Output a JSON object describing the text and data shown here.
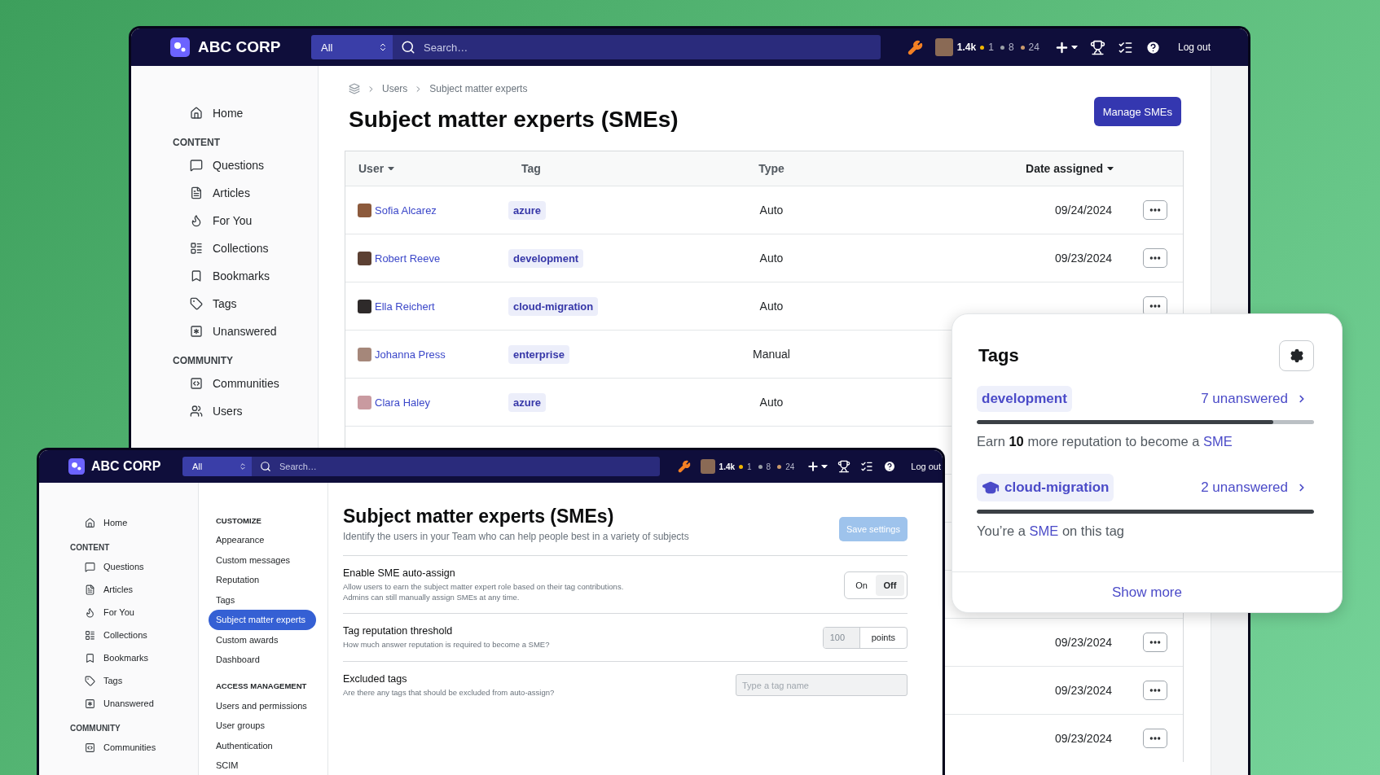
{
  "back_window": {
    "header": {
      "brand": "ABC CORP",
      "search_scope": "All",
      "search_placeholder": "Search…",
      "reputation": "1.4k",
      "badges": [
        {
          "count": "1",
          "color": "#f1b600"
        },
        {
          "count": "8",
          "color": "#9a9fa5"
        },
        {
          "count": "24",
          "color": "#c9996b"
        }
      ],
      "logout": "Log out"
    },
    "sidebar": [
      {
        "items": [
          "Home"
        ]
      },
      {
        "heading": "CONTENT",
        "items": [
          "Questions",
          "Articles",
          "For You",
          "Collections",
          "Bookmarks",
          "Tags",
          "Unanswered"
        ]
      },
      {
        "heading": "COMMUNITY",
        "items": [
          "Communities",
          "Users"
        ]
      }
    ],
    "breadcrumb": [
      "Users",
      "Subject matter experts"
    ],
    "title": "Subject matter experts (SMEs)",
    "manage_button": "Manage SMEs",
    "table": {
      "columns": [
        {
          "label": "User",
          "sortable": true,
          "selected": false
        },
        {
          "label": "Tag",
          "sortable": false,
          "selected": false
        },
        {
          "label": "Type",
          "sortable": false,
          "selected": false
        },
        {
          "label": "Date assigned",
          "sortable": true,
          "selected": true
        }
      ],
      "rows": [
        {
          "user": "Sofia Alcarez",
          "tag": "azure",
          "type": "Auto",
          "date": "09/24/2024"
        },
        {
          "user": "Robert Reeve",
          "tag": "development",
          "type": "Auto",
          "date": "09/23/2024"
        },
        {
          "user": "Ella Reichert",
          "tag": "cloud-migration",
          "type": "Auto"
        },
        {
          "user": "Johanna Press",
          "tag": "enterprise",
          "type": "Manual"
        },
        {
          "user": "Clara Haley",
          "tag": "azure",
          "type": "Auto"
        }
      ],
      "lower_rows": [
        {
          "date": "09/23/2024"
        },
        {
          "date": "09/23/2024"
        },
        {
          "date": "09/23/2024"
        }
      ]
    }
  },
  "front_window": {
    "header": {
      "brand": "ABC CORP",
      "search_scope": "All",
      "search_placeholder": "Search…",
      "reputation": "1.4k",
      "badges": [
        {
          "count": "1",
          "color": "#f1b600"
        },
        {
          "count": "8",
          "color": "#9a9fa5"
        },
        {
          "count": "24",
          "color": "#c9996b"
        }
      ],
      "logout": "Log out"
    },
    "sidebar": [
      {
        "items": [
          "Home"
        ]
      },
      {
        "heading": "CONTENT",
        "items": [
          "Questions",
          "Articles",
          "For You",
          "Collections",
          "Bookmarks",
          "Tags",
          "Unanswered"
        ]
      },
      {
        "heading": "COMMUNITY",
        "items": [
          "Communities"
        ]
      }
    ],
    "settings_nav": [
      {
        "heading": "CUSTOMIZE",
        "items": [
          {
            "label": "Appearance",
            "selected": false
          },
          {
            "label": "Custom messages",
            "selected": false
          },
          {
            "label": "Reputation",
            "selected": false
          },
          {
            "label": "Tags",
            "selected": false
          },
          {
            "label": "Subject matter experts",
            "selected": true
          },
          {
            "label": "Custom awards",
            "selected": false
          },
          {
            "label": "Dashboard",
            "selected": false
          }
        ]
      },
      {
        "heading": "ACCESS MANAGEMENT",
        "items": [
          {
            "label": "Users and permissions",
            "selected": false
          },
          {
            "label": "User groups",
            "selected": false
          },
          {
            "label": "Authentication",
            "selected": false
          },
          {
            "label": "SCIM",
            "selected": false
          }
        ]
      }
    ],
    "page": {
      "title": "Subject matter experts (SMEs)",
      "subtitle": "Identify the users in your Team who can help people best in a variety of subjects",
      "save_button": {
        "label": "Save settings",
        "disabled": true
      },
      "settings": [
        {
          "kind": "toggle",
          "label": "Enable SME auto-assign",
          "description": [
            "Allow users to earn the subject matter expert role based on their tag contributions.",
            "Admins can still manually assign SMEs at any time."
          ],
          "options": [
            {
              "label": "On",
              "selected": false
            },
            {
              "label": "Off",
              "selected": true
            }
          ]
        },
        {
          "kind": "number",
          "label": "Tag reputation threshold",
          "description": [
            "How much answer reputation is required to become a SME?"
          ],
          "value": "100",
          "unit": "points"
        },
        {
          "kind": "tags",
          "label": "Excluded tags",
          "description": [
            "Are there any tags that should be excluded from auto-assign?"
          ],
          "placeholder": "Type a tag name"
        }
      ]
    }
  },
  "tags_card": {
    "title": "Tags",
    "tags": [
      {
        "label": "development",
        "sme": false,
        "unanswered": "7 unanswered",
        "level": 0.88,
        "note_before": "Earn **10** more reputation to become a ",
        "note_link": "SME"
      },
      {
        "label": "cloud-migration",
        "sme": true,
        "unanswered": "2 unanswered",
        "level": 1,
        "note_before": "You’re a ",
        "note_link": "SME",
        "note_after": " on this tag"
      }
    ],
    "show_more": "Show more"
  }
}
